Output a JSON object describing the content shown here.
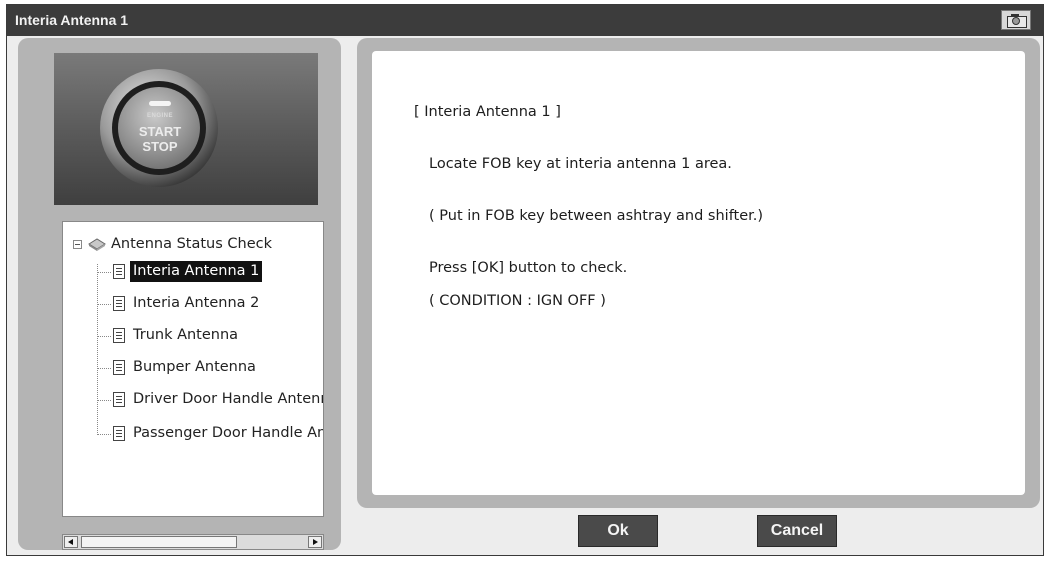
{
  "window": {
    "title": "Interia Antenna 1"
  },
  "toolbar": {
    "camera_icon": "camera-icon"
  },
  "photo": {
    "icon": "start-stop-button-photo",
    "small_text": "ENGINE",
    "start_text": "START",
    "stop_text": "STOP"
  },
  "tree": {
    "root": {
      "label": "Antenna Status Check",
      "icon": "folder-icon",
      "expanded": true
    },
    "items": [
      {
        "label": "Interia Antenna 1",
        "selected": true
      },
      {
        "label": "Interia Antenna 2",
        "selected": false
      },
      {
        "label": "Trunk Antenna",
        "selected": false
      },
      {
        "label": "Bumper Antenna",
        "selected": false
      },
      {
        "label": "Driver Door Handle Antenna",
        "selected": false
      },
      {
        "label": "Passenger Door Handle Antenna",
        "selected": false
      }
    ]
  },
  "content": {
    "heading": "[ Interia Antenna 1 ]",
    "line1": "Locate FOB key at interia antenna 1 area.",
    "line2": "( Put in FOB key between ashtray and shifter.)",
    "line3": "Press [OK] button to check.",
    "line4": "( CONDITION : IGN OFF )"
  },
  "buttons": {
    "ok": "Ok",
    "cancel": "Cancel"
  }
}
